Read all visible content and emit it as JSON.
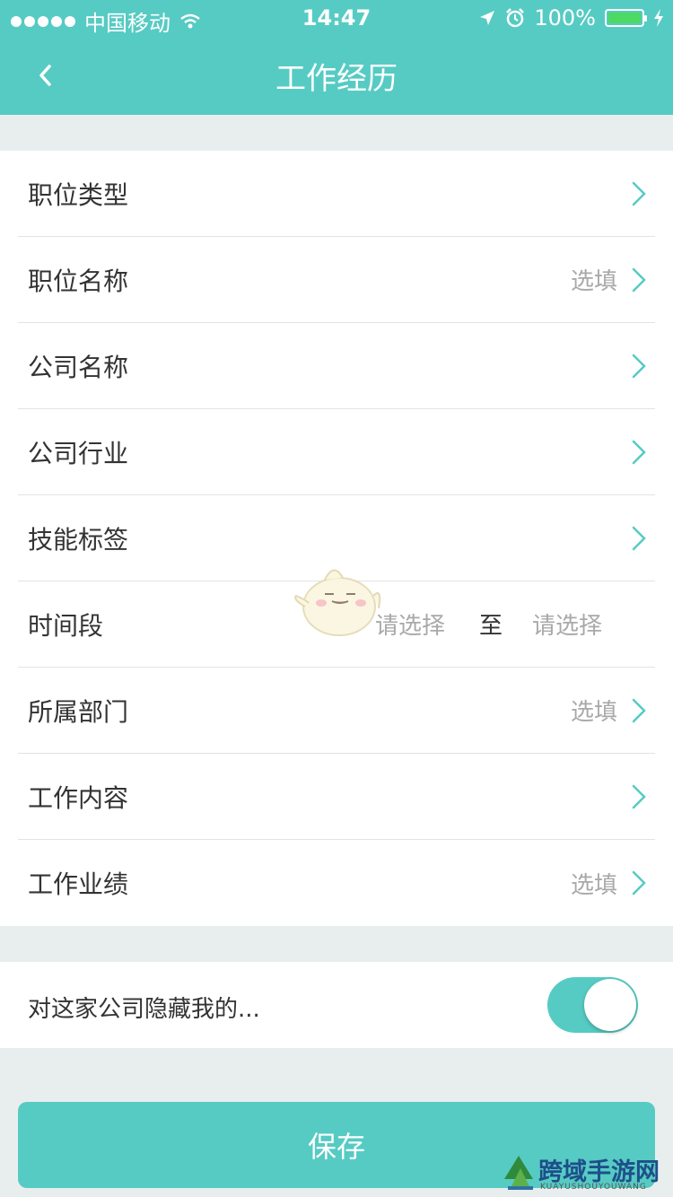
{
  "status_bar": {
    "carrier": "中国移动",
    "time": "14:47",
    "battery": "100%"
  },
  "nav": {
    "title": "工作经历"
  },
  "form": {
    "rows": [
      {
        "label": "职位类型",
        "hint": ""
      },
      {
        "label": "职位名称",
        "hint": "选填"
      },
      {
        "label": "公司名称",
        "hint": ""
      },
      {
        "label": "公司行业",
        "hint": ""
      },
      {
        "label": "技能标签",
        "hint": ""
      },
      {
        "label": "时间段",
        "start": "请选择",
        "separator": "至",
        "end": "请选择"
      },
      {
        "label": "所属部门",
        "hint": "选填"
      },
      {
        "label": "工作内容",
        "hint": ""
      },
      {
        "label": "工作业绩",
        "hint": "选填"
      }
    ]
  },
  "privacy": {
    "label": "对这家公司隐藏我的...",
    "toggle_on": true
  },
  "save_label": "保存",
  "watermark": {
    "title": "跨域手游网",
    "subtitle": "KUAYUSHOUYOUWANG"
  },
  "colors": {
    "accent": "#56cbc3",
    "background": "#e8eeee",
    "hint": "#a9a9a9",
    "text": "#333333"
  },
  "icons": [
    "wifi-icon",
    "location-arrow-icon",
    "alarm-icon",
    "battery-icon",
    "charging-icon",
    "back-chevron-icon",
    "chevron-right-icon"
  ]
}
